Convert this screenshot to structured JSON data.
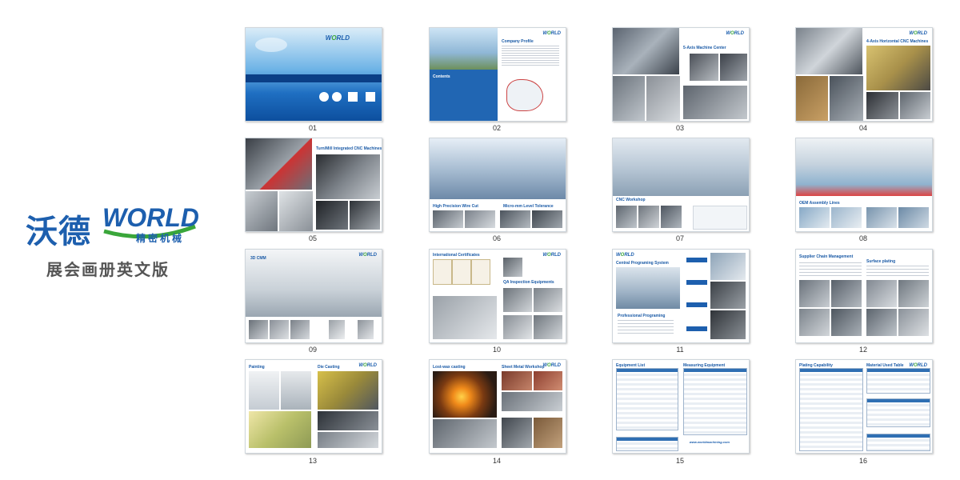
{
  "brand": {
    "name_cn": "沃德",
    "logo_text": "WORLD",
    "subtitle_cn": "精密机械",
    "title_cn": "展会画册英文版"
  },
  "colors": {
    "brand_blue": "#1d5fae",
    "brand_green": "#3aa63a"
  },
  "pages": [
    {
      "number": "01",
      "header": "",
      "header2": ""
    },
    {
      "number": "02",
      "header": "Company Profile",
      "header2": "Contents"
    },
    {
      "number": "03",
      "header": "5-Axis Machine Center",
      "header2": ""
    },
    {
      "number": "04",
      "header": "4-Axis Horizontal CNC Machines",
      "header2": ""
    },
    {
      "number": "05",
      "header": "Turn/Mill Integrated CNC Machines",
      "header2": ""
    },
    {
      "number": "06",
      "header": "High Precision Wire Cut",
      "header2": "Micro-mm Level Tolerance"
    },
    {
      "number": "07",
      "header": "CNC Workshop",
      "header2": ""
    },
    {
      "number": "08",
      "header": "OEM Assembly Lines",
      "header2": ""
    },
    {
      "number": "09",
      "header": "3D CMM",
      "header2": ""
    },
    {
      "number": "10",
      "header": "International Certificates",
      "header2": "QA Inspection Equipments"
    },
    {
      "number": "11",
      "header": "Central Programing System",
      "header2": "Professional Programing"
    },
    {
      "number": "12",
      "header": "Supplier Chain Management",
      "header2": "Surface plating"
    },
    {
      "number": "13",
      "header": "Painting",
      "header2": "Die Casting"
    },
    {
      "number": "14",
      "header": "Lost-wax casting",
      "header2": "Sheet Metal Workshop"
    },
    {
      "number": "15",
      "header": "Equipment List",
      "header2": "Measuring Equipment"
    },
    {
      "number": "16",
      "header": "Plating Capability",
      "header2": "Material Used Table"
    }
  ]
}
